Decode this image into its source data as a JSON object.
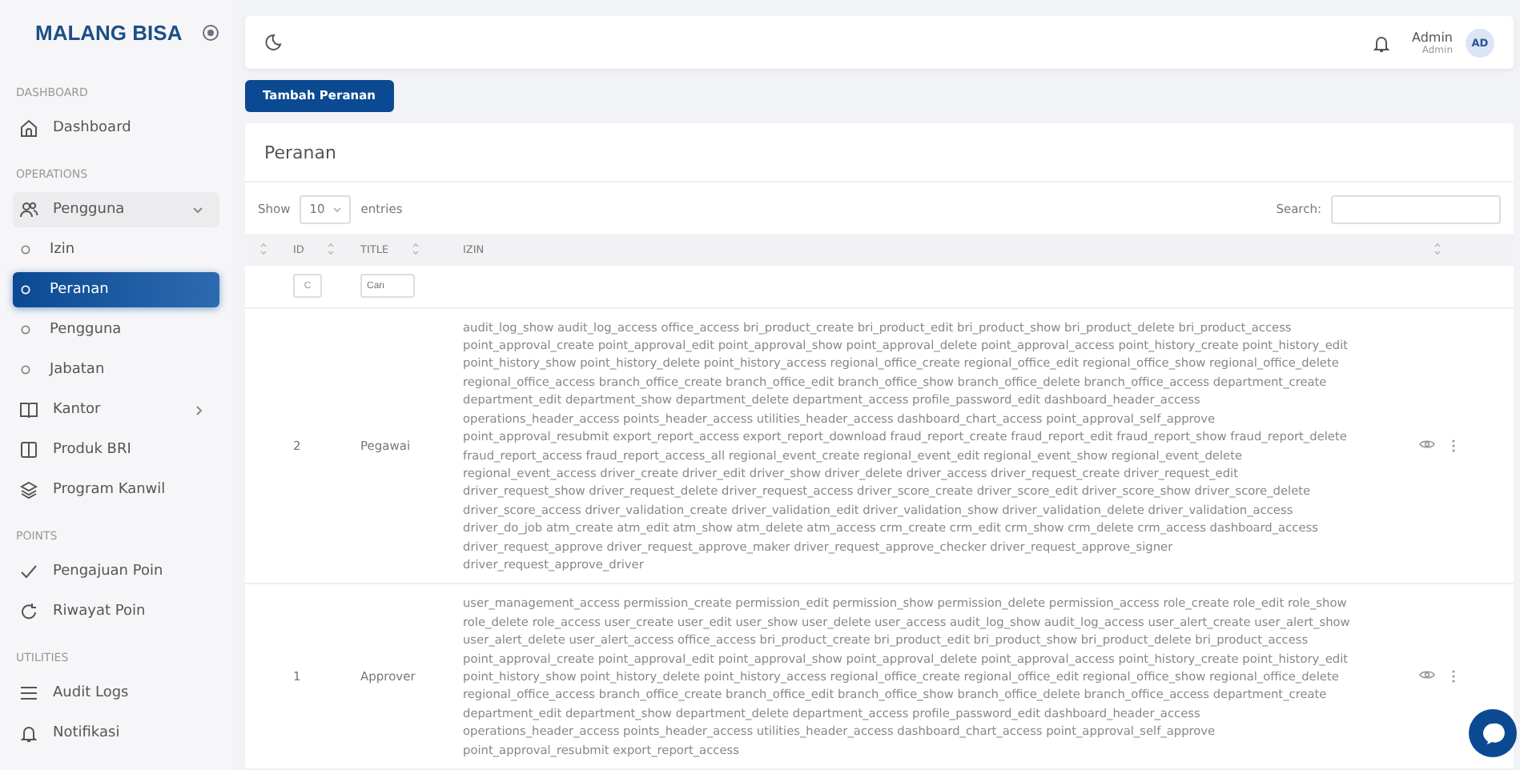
{
  "brand": "MALANG BISA",
  "sidebar": {
    "sections": [
      {
        "heading": "DASHBOARD",
        "items": [
          {
            "label": "Dashboard",
            "selected": false
          }
        ]
      },
      {
        "heading": "OPERATIONS",
        "items": [
          {
            "label": "Pengguna",
            "selected": false,
            "expanded": true,
            "children": [
              {
                "label": "Izin",
                "selected": false
              },
              {
                "label": "Peranan",
                "selected": true
              },
              {
                "label": "Pengguna",
                "selected": false
              },
              {
                "label": "Jabatan",
                "selected": false
              }
            ]
          },
          {
            "label": "Kantor",
            "selected": false,
            "expanded": false
          },
          {
            "label": "Produk BRI",
            "selected": false
          },
          {
            "label": "Program Kanwil",
            "selected": false
          }
        ]
      },
      {
        "heading": "POINTS",
        "items": [
          {
            "label": "Pengajuan Poin",
            "selected": false
          },
          {
            "label": "Riwayat Poin",
            "selected": false
          }
        ]
      },
      {
        "heading": "UTILITIES",
        "items": [
          {
            "label": "Audit Logs",
            "selected": false
          },
          {
            "label": "Notifikasi",
            "selected": false
          }
        ]
      }
    ]
  },
  "header": {
    "user_name": "Admin",
    "user_role": "Admin",
    "avatar": "AD"
  },
  "add_button": "Tambah Peranan",
  "card": {
    "title": "Peranan",
    "show_label": "Show",
    "page_size": "10",
    "entries_label": "entries",
    "search_label": "Search:"
  },
  "table": {
    "columns": [
      {
        "label": "ID"
      },
      {
        "label": "TITLE"
      },
      {
        "label": "IZIN"
      }
    ],
    "filters": [
      {
        "value": "C"
      },
      {
        "placeholder": "Cari"
      }
    ],
    "rows": [
      {
        "id": "2",
        "title": "Pegawai",
        "izin": "audit_log_show audit_log_access office_access bri_product_create bri_product_edit bri_product_show bri_product_delete bri_product_access point_approval_create point_approval_edit point_approval_show point_approval_delete point_approval_access point_history_create point_history_edit point_history_show point_history_delete point_history_access regional_office_create regional_office_edit regional_office_show regional_office_delete regional_office_access branch_office_create branch_office_edit branch_office_show branch_office_delete branch_office_access department_create department_edit department_show department_delete department_access profile_password_edit dashboard_header_access operations_header_access points_header_access utilities_header_access dashboard_chart_access point_approval_self_approve point_approval_resubmit export_report_access export_report_download fraud_report_create fraud_report_edit fraud_report_show fraud_report_delete fraud_report_access fraud_report_access_all regional_event_create regional_event_edit regional_event_show regional_event_delete regional_event_access driver_create driver_edit driver_show driver_delete driver_access driver_request_create driver_request_edit driver_request_show driver_request_delete driver_request_access driver_score_create driver_score_edit driver_score_show driver_score_delete driver_score_access driver_validation_create driver_validation_edit driver_validation_show driver_validation_delete driver_validation_access driver_do_job atm_create atm_edit atm_show atm_delete atm_access crm_create crm_edit crm_show crm_delete crm_access dashboard_access driver_request_approve driver_request_approve_maker driver_request_approve_checker driver_request_approve_signer driver_request_approve_driver"
      },
      {
        "id": "1",
        "title": "Approver",
        "izin": "user_management_access permission_create permission_edit permission_show permission_delete permission_access role_create role_edit role_show role_delete role_access user_create user_edit user_show user_delete user_access audit_log_show audit_log_access user_alert_create user_alert_show user_alert_delete user_alert_access office_access bri_product_create bri_product_edit bri_product_show bri_product_delete bri_product_access point_approval_create point_approval_edit point_approval_show point_approval_delete point_approval_access point_history_create point_history_edit point_history_show point_history_delete point_history_access regional_office_create regional_office_edit regional_office_show regional_office_delete regional_office_access branch_office_create branch_office_edit branch_office_show branch_office_delete branch_office_access department_create department_edit department_show department_delete department_access profile_password_edit dashboard_header_access operations_header_access points_header_access utilities_header_access dashboard_chart_access point_approval_self_approve point_approval_resubmit export_report_access"
      }
    ]
  }
}
